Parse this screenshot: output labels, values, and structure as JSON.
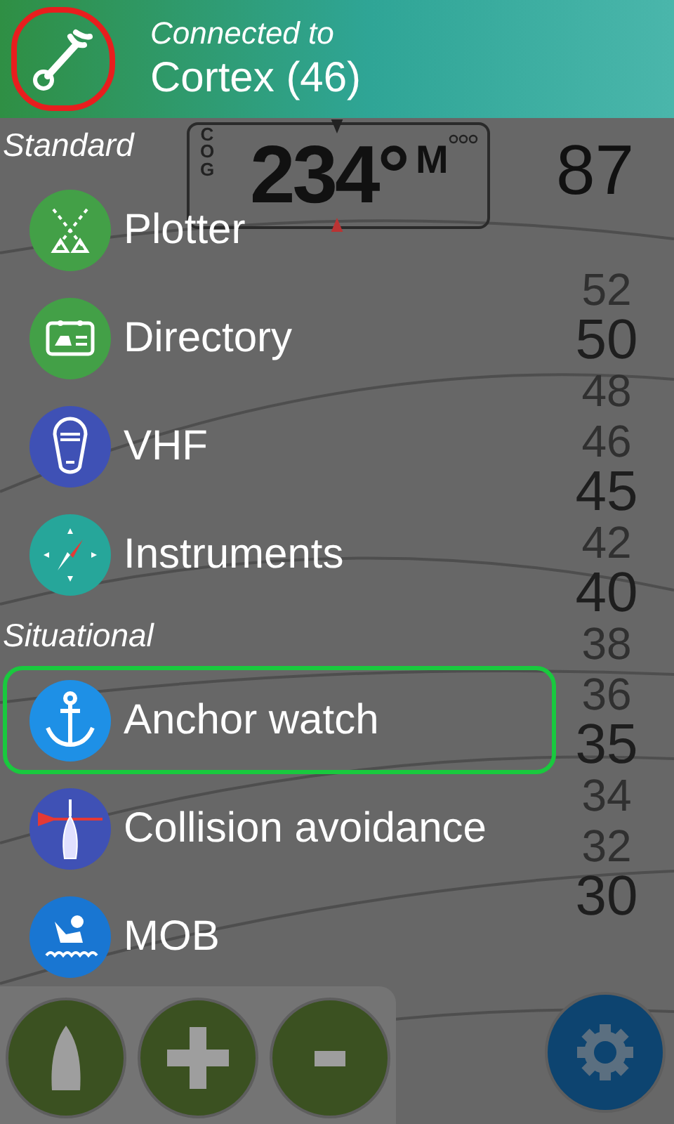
{
  "header": {
    "circled": true,
    "subtitle": "Connected to",
    "title": "Cortex (46)"
  },
  "instrument": {
    "label": "COG",
    "value": "234°",
    "unit": "M",
    "side_value": "87"
  },
  "scale": [
    {
      "text": "52",
      "kind": "minor"
    },
    {
      "text": "50",
      "kind": "major"
    },
    {
      "text": "48",
      "kind": "minor"
    },
    {
      "text": "46",
      "kind": "minor"
    },
    {
      "text": "45",
      "kind": "major"
    },
    {
      "text": "42",
      "kind": "minor"
    },
    {
      "text": "40",
      "kind": "major"
    },
    {
      "text": "38",
      "kind": "minor"
    },
    {
      "text": "36",
      "kind": "minor"
    },
    {
      "text": "35",
      "kind": "major"
    },
    {
      "text": "34",
      "kind": "minor"
    },
    {
      "text": "32",
      "kind": "minor"
    },
    {
      "text": "30",
      "kind": "major"
    }
  ],
  "sections": [
    {
      "title": "Standard",
      "items": [
        {
          "label": "Plotter",
          "kind": "plotter",
          "color": "#43a047",
          "highlighted": false
        },
        {
          "label": "Directory",
          "kind": "directory",
          "color": "#43a047",
          "highlighted": false
        },
        {
          "label": "VHF",
          "kind": "vhf",
          "color": "#3f51b5",
          "highlighted": false
        },
        {
          "label": "Instruments",
          "kind": "instruments",
          "color": "#26a69a",
          "highlighted": false
        }
      ]
    },
    {
      "title": "Situational",
      "items": [
        {
          "label": "Anchor watch",
          "kind": "anchor",
          "color": "#1e90e6",
          "highlighted": true
        },
        {
          "label": "Collision avoidance",
          "kind": "collision",
          "color": "#3f51b5",
          "highlighted": false
        },
        {
          "label": "MOB",
          "kind": "mob",
          "color": "#1976d2",
          "highlighted": false
        }
      ]
    }
  ],
  "map_buttons": [
    {
      "kind": "boat"
    },
    {
      "kind": "plus"
    },
    {
      "kind": "minus"
    },
    {
      "kind": "settings"
    }
  ]
}
